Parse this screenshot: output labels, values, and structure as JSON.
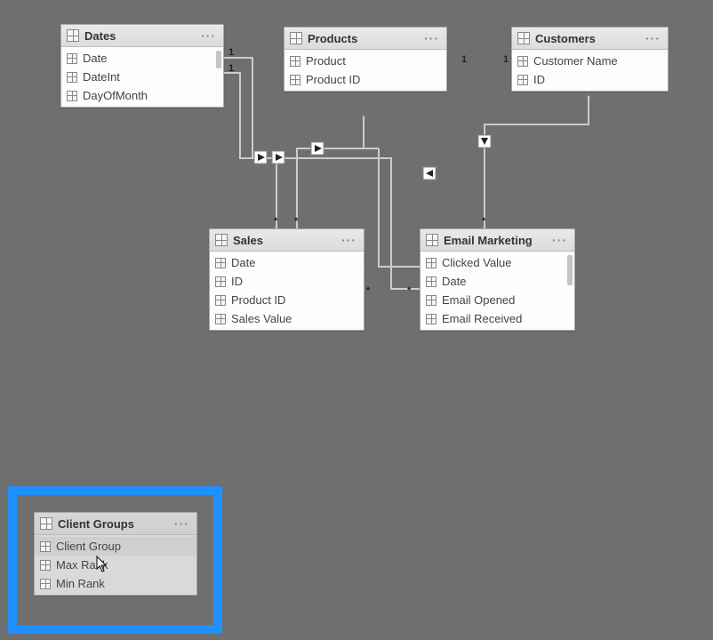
{
  "tables": {
    "dates": {
      "title": "Dates",
      "fields": [
        "Date",
        "DateInt",
        "DayOfMonth"
      ]
    },
    "products": {
      "title": "Products",
      "fields": [
        "Product",
        "Product ID"
      ]
    },
    "customers": {
      "title": "Customers",
      "fields": [
        "Customer Name",
        "ID"
      ]
    },
    "sales": {
      "title": "Sales",
      "fields": [
        "Date",
        "ID",
        "Product ID",
        "Sales Value"
      ]
    },
    "emailMarketing": {
      "title": "Email Marketing",
      "fields": [
        "Clicked Value",
        "Date",
        "Email Opened",
        "Email Received"
      ]
    },
    "clientGroups": {
      "title": "Client Groups",
      "fields": [
        "Client Group",
        "Max Rank",
        "Min Rank"
      ]
    }
  },
  "relationships": {
    "labels": {
      "one": "1",
      "many": "*"
    }
  },
  "menu": {
    "ellipsis": "···"
  }
}
